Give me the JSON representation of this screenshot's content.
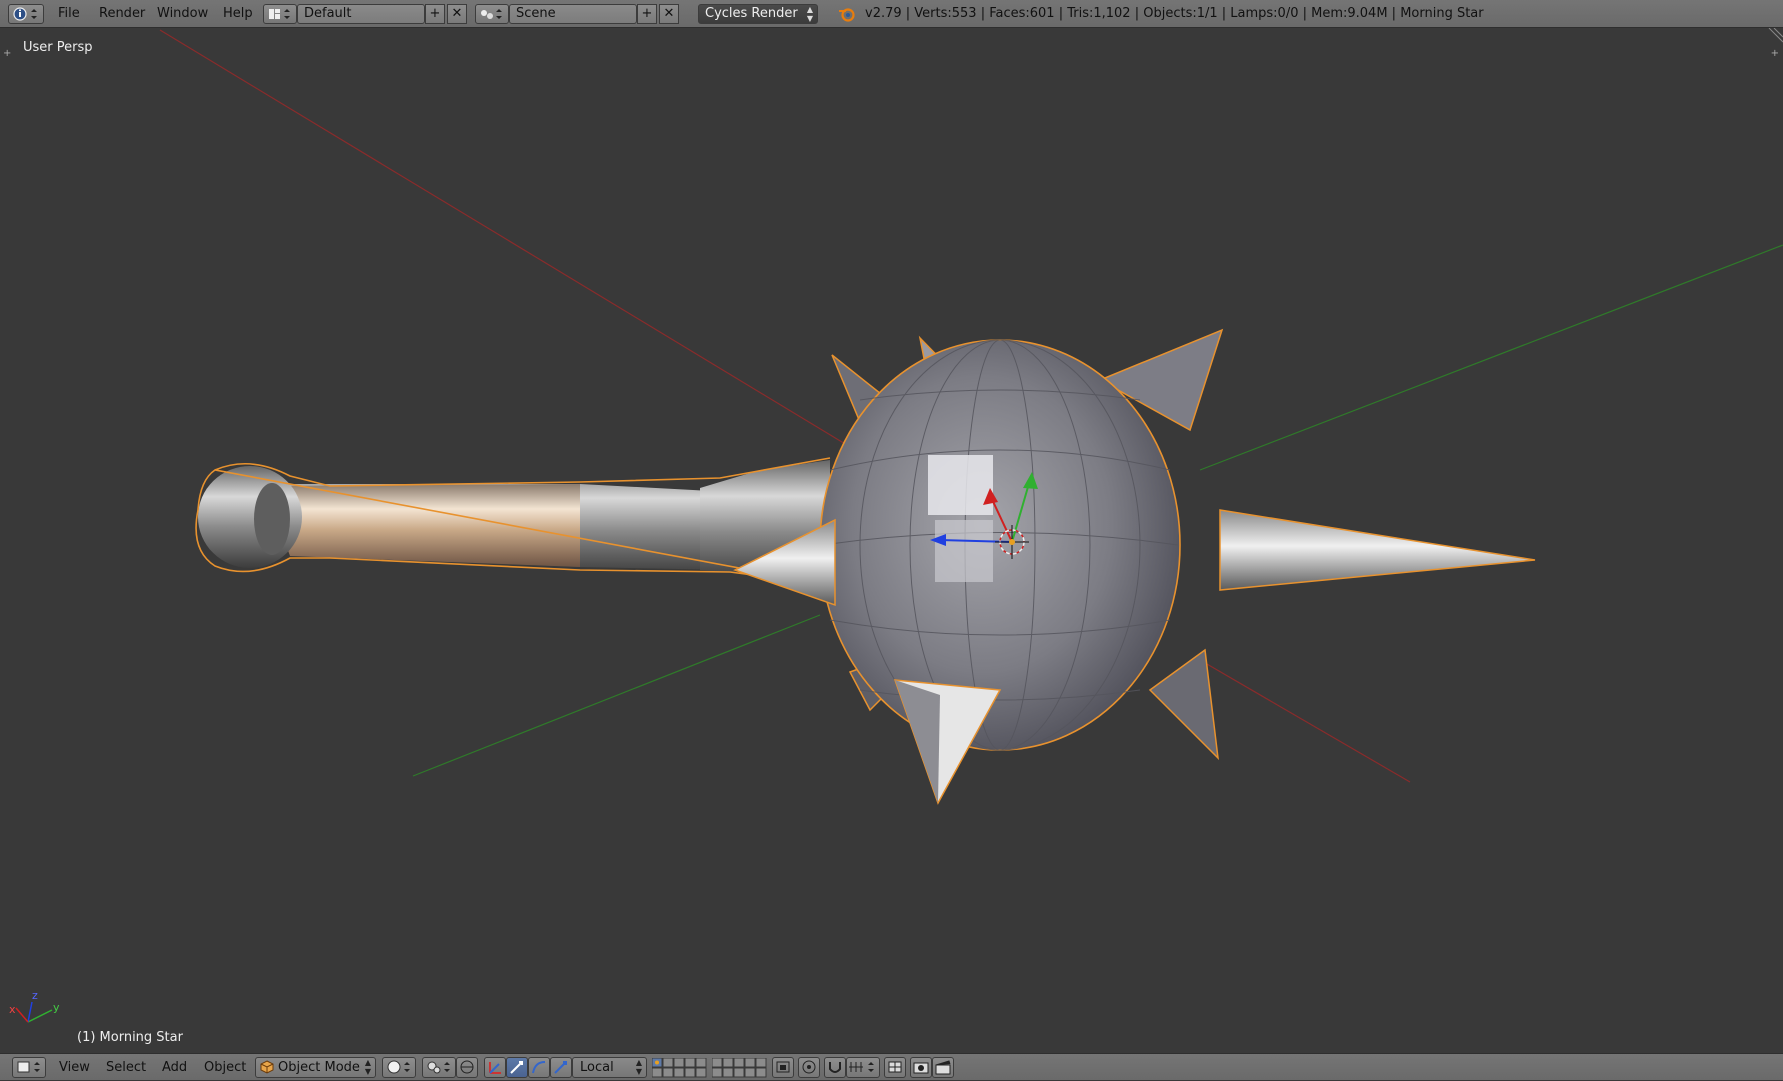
{
  "top_menu": {
    "info_icon": "info-icon",
    "items": [
      "File",
      "Render",
      "Window",
      "Help"
    ],
    "screen_layout": "Default",
    "scene": "Scene",
    "render_engine": "Cycles Render",
    "status": "v2.79 | Verts:553 | Faces:601 | Tris:1,102 | Objects:1/1 | Lamps:0/0 | Mem:9.04M | Morning Star"
  },
  "viewport": {
    "view_label": "User Persp",
    "object_label": "(1) Morning Star",
    "axes": {
      "x": "x",
      "y": "y",
      "z": "z"
    }
  },
  "bottom_menu": {
    "items": [
      "View",
      "Select",
      "Add",
      "Object"
    ],
    "mode": "Object Mode",
    "orientation": "Local"
  },
  "colors": {
    "header": "#727272",
    "viewport": "#393939",
    "selection_outline": "#e8922e",
    "x_axis": "#c83232",
    "y_axis": "#3a9a2a",
    "z_axis": "#2a48d0"
  }
}
